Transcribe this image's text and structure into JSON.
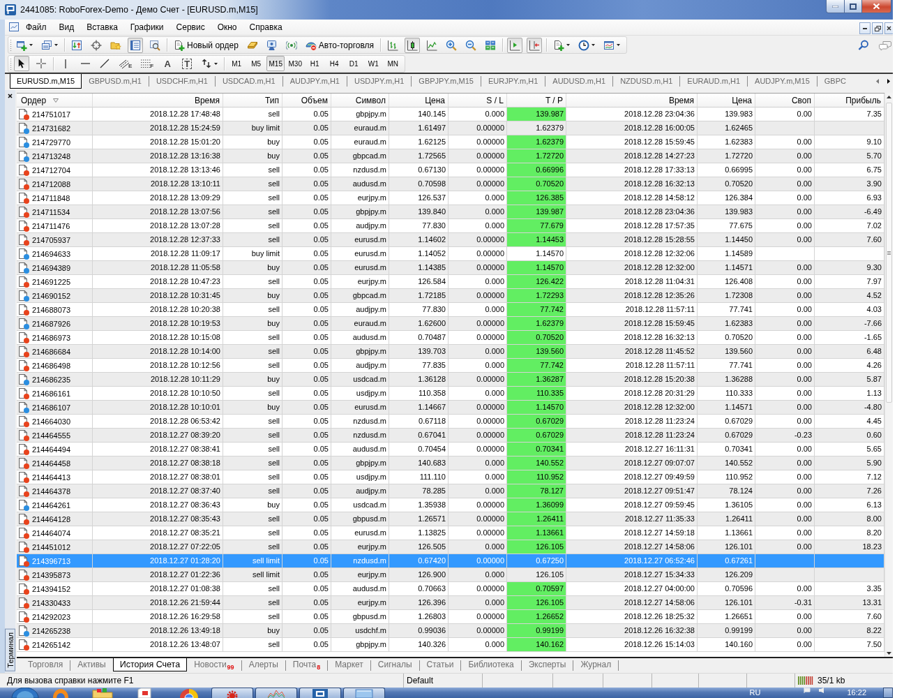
{
  "window": {
    "title": "2441085: RoboForex-Demo - Демо Счет - [EURUSD.m,M15]"
  },
  "menu": [
    "Файл",
    "Вид",
    "Вставка",
    "Графики",
    "Сервис",
    "Окно",
    "Справка"
  ],
  "toolbar_standard": [
    [
      {
        "kind": "newchart",
        "pressed": false
      },
      {
        "kind": "profiles",
        "pressed": false
      }
    ],
    [
      {
        "kind": "marketwatch",
        "pressed": false
      },
      {
        "kind": "datawindow",
        "pressed": false
      },
      {
        "kind": "navigator",
        "pressed": false
      },
      {
        "kind": "terminal",
        "pressed": true
      },
      {
        "kind": "tester",
        "pressed": false
      }
    ],
    [
      {
        "kind": "neworder",
        "label": "Новый ордер",
        "pressed": false
      },
      {
        "kind": "editor",
        "pressed": false
      },
      {
        "kind": "market",
        "pressed": false
      },
      {
        "kind": "signals",
        "pressed": false
      },
      {
        "kind": "autotrading",
        "label": "Авто-торговля",
        "pressed": false
      }
    ],
    [
      {
        "kind": "bars",
        "pressed": false
      },
      {
        "kind": "candles",
        "pressed": true
      },
      {
        "kind": "line",
        "pressed": false
      },
      {
        "kind": "zoomin",
        "pressed": false
      },
      {
        "kind": "zoomout",
        "pressed": false
      },
      {
        "kind": "tile",
        "pressed": false
      }
    ],
    [
      {
        "kind": "autoscroll",
        "pressed": true
      },
      {
        "kind": "shift",
        "pressed": true
      }
    ],
    [
      {
        "kind": "indicators",
        "pressed": false
      },
      {
        "kind": "periods",
        "pressed": false
      },
      {
        "kind": "templates",
        "pressed": false
      }
    ]
  ],
  "toolbar_drawing": [
    [
      {
        "kind": "cursor",
        "pressed": true
      },
      {
        "kind": "crosshair",
        "pressed": false
      }
    ],
    [
      {
        "kind": "vline",
        "pressed": false
      },
      {
        "kind": "hline",
        "pressed": false
      },
      {
        "kind": "trendline",
        "pressed": false
      },
      {
        "kind": "channel",
        "glyph": "E",
        "pressed": false
      },
      {
        "kind": "fibo",
        "glyph": "F",
        "pressed": false
      },
      {
        "kind": "text",
        "glyph": "A",
        "pressed": false
      },
      {
        "kind": "label",
        "glyph": "T",
        "pressed": false
      },
      {
        "kind": "arrows",
        "pressed": false
      }
    ]
  ],
  "timeframes": [
    {
      "label": "M1",
      "selected": false
    },
    {
      "label": "M5",
      "selected": false
    },
    {
      "label": "M15",
      "selected": true
    },
    {
      "label": "M30",
      "selected": false
    },
    {
      "label": "H1",
      "selected": false
    },
    {
      "label": "H4",
      "selected": false
    },
    {
      "label": "D1",
      "selected": false
    },
    {
      "label": "W1",
      "selected": false
    },
    {
      "label": "MN",
      "selected": false
    }
  ],
  "chart_tabs": [
    {
      "label": "EURUSD.m,M15",
      "selected": true
    },
    {
      "label": "GBPUSD.m,H1",
      "selected": false
    },
    {
      "label": "USDCHF.m,H1",
      "selected": false
    },
    {
      "label": "USDCAD.m,H1",
      "selected": false
    },
    {
      "label": "AUDJPY.m,H1",
      "selected": false
    },
    {
      "label": "USDJPY.m,H1",
      "selected": false
    },
    {
      "label": "GBPJPY.m,M15",
      "selected": false
    },
    {
      "label": "EURJPY.m,H1",
      "selected": false
    },
    {
      "label": "AUDUSD.m,H1",
      "selected": false
    },
    {
      "label": "NZDUSD.m,H1",
      "selected": false
    },
    {
      "label": "EURAUD.m,H1",
      "selected": false
    },
    {
      "label": "AUDJPY.m,M15",
      "selected": false
    },
    {
      "label": "GBPC",
      "selected": false
    }
  ],
  "terminal": {
    "title": "Терминал",
    "columns": [
      {
        "label": "Ордер",
        "sorted": true
      },
      {
        "label": "Время",
        "sorted": false
      },
      {
        "label": "Тип",
        "sorted": false
      },
      {
        "label": "Объем",
        "sorted": false
      },
      {
        "label": "Символ",
        "sorted": false
      },
      {
        "label": "Цена",
        "sorted": false
      },
      {
        "label": "S / L",
        "sorted": false
      },
      {
        "label": "T / P",
        "sorted": false
      },
      {
        "label": "Время",
        "sorted": false
      },
      {
        "label": "Цена",
        "sorted": false
      },
      {
        "label": "Своп",
        "sorted": false
      },
      {
        "label": "Прибыль",
        "sorted": false
      }
    ],
    "rows": [
      {
        "order": "214751017",
        "color": "#e8431d",
        "time": "2018.12.28 17:48:48",
        "type": "sell",
        "volume": "0.05",
        "symbol": "gbpjpy.m",
        "price": "140.145",
        "sl": "0.000",
        "tp": "139.987",
        "tp_hit": true,
        "close_time": "2018.12.28 23:04:36",
        "close_price": "139.983",
        "swap": "0.00",
        "profit": "7.35",
        "selected": false
      },
      {
        "order": "214731682",
        "color": "#2b8ee0",
        "time": "2018.12.28 15:24:59",
        "type": "buy limit",
        "volume": "0.05",
        "symbol": "euraud.m",
        "price": "1.61497",
        "sl": "0.00000",
        "tp": "1.62379",
        "tp_hit": false,
        "close_time": "2018.12.28 16:00:05",
        "close_price": "1.62465",
        "selected": false
      },
      {
        "order": "214729770",
        "color": "#2b8ee0",
        "time": "2018.12.28 15:01:20",
        "type": "buy",
        "volume": "0.05",
        "symbol": "euraud.m",
        "price": "1.62125",
        "sl": "0.00000",
        "tp": "1.62379",
        "tp_hit": true,
        "close_time": "2018.12.28 15:59:45",
        "close_price": "1.62383",
        "swap": "0.00",
        "profit": "9.10",
        "selected": false
      },
      {
        "order": "214713248",
        "color": "#2b8ee0",
        "time": "2018.12.28 13:16:38",
        "type": "buy",
        "volume": "0.05",
        "symbol": "gbpcad.m",
        "price": "1.72565",
        "sl": "0.00000",
        "tp": "1.72720",
        "tp_hit": true,
        "close_time": "2018.12.28 14:27:23",
        "close_price": "1.72720",
        "swap": "0.00",
        "profit": "5.70",
        "selected": false
      },
      {
        "order": "214712704",
        "color": "#e8431d",
        "time": "2018.12.28 13:13:46",
        "type": "sell",
        "volume": "0.05",
        "symbol": "nzdusd.m",
        "price": "0.67130",
        "sl": "0.00000",
        "tp": "0.66996",
        "tp_hit": true,
        "close_time": "2018.12.28 17:33:13",
        "close_price": "0.66995",
        "swap": "0.00",
        "profit": "6.75",
        "selected": false
      },
      {
        "order": "214712088",
        "color": "#e8431d",
        "time": "2018.12.28 13:10:11",
        "type": "sell",
        "volume": "0.05",
        "symbol": "audusd.m",
        "price": "0.70598",
        "sl": "0.00000",
        "tp": "0.70520",
        "tp_hit": true,
        "close_time": "2018.12.28 16:32:13",
        "close_price": "0.70520",
        "swap": "0.00",
        "profit": "3.90",
        "selected": false
      },
      {
        "order": "214711848",
        "color": "#e8431d",
        "time": "2018.12.28 13:09:29",
        "type": "sell",
        "volume": "0.05",
        "symbol": "eurjpy.m",
        "price": "126.537",
        "sl": "0.000",
        "tp": "126.385",
        "tp_hit": true,
        "close_time": "2018.12.28 14:58:12",
        "close_price": "126.384",
        "swap": "0.00",
        "profit": "6.93",
        "selected": false
      },
      {
        "order": "214711534",
        "color": "#e8431d",
        "time": "2018.12.28 13:07:56",
        "type": "sell",
        "volume": "0.05",
        "symbol": "gbpjpy.m",
        "price": "139.840",
        "sl": "0.000",
        "tp": "139.987",
        "tp_hit": true,
        "close_time": "2018.12.28 23:04:36",
        "close_price": "139.983",
        "swap": "0.00",
        "profit": "-6.49",
        "selected": false
      },
      {
        "order": "214711476",
        "color": "#e8431d",
        "time": "2018.12.28 13:07:28",
        "type": "sell",
        "volume": "0.05",
        "symbol": "audjpy.m",
        "price": "77.830",
        "sl": "0.000",
        "tp": "77.679",
        "tp_hit": true,
        "close_time": "2018.12.28 17:57:35",
        "close_price": "77.675",
        "swap": "0.00",
        "profit": "7.02",
        "selected": false
      },
      {
        "order": "214705937",
        "color": "#e8431d",
        "time": "2018.12.28 12:37:33",
        "type": "sell",
        "volume": "0.05",
        "symbol": "eurusd.m",
        "price": "1.14602",
        "sl": "0.00000",
        "tp": "1.14453",
        "tp_hit": true,
        "close_time": "2018.12.28 15:28:55",
        "close_price": "1.14450",
        "swap": "0.00",
        "profit": "7.60",
        "selected": false
      },
      {
        "order": "214694633",
        "color": "#2b8ee0",
        "time": "2018.12.28 11:09:17",
        "type": "buy limit",
        "volume": "0.05",
        "symbol": "eurusd.m",
        "price": "1.14052",
        "sl": "0.00000",
        "tp": "1.14570",
        "tp_hit": false,
        "close_time": "2018.12.28 12:32:06",
        "close_price": "1.14589",
        "selected": false
      },
      {
        "order": "214694389",
        "color": "#2b8ee0",
        "time": "2018.12.28 11:05:58",
        "type": "buy",
        "volume": "0.05",
        "symbol": "eurusd.m",
        "price": "1.14385",
        "sl": "0.00000",
        "tp": "1.14570",
        "tp_hit": true,
        "close_time": "2018.12.28 12:32:00",
        "close_price": "1.14571",
        "swap": "0.00",
        "profit": "9.30",
        "selected": false
      },
      {
        "order": "214691225",
        "color": "#e8431d",
        "time": "2018.12.28 10:47:23",
        "type": "sell",
        "volume": "0.05",
        "symbol": "eurjpy.m",
        "price": "126.584",
        "sl": "0.000",
        "tp": "126.422",
        "tp_hit": true,
        "close_time": "2018.12.28 11:04:31",
        "close_price": "126.408",
        "swap": "0.00",
        "profit": "7.97",
        "selected": false
      },
      {
        "order": "214690152",
        "color": "#2b8ee0",
        "time": "2018.12.28 10:31:45",
        "type": "buy",
        "volume": "0.05",
        "symbol": "gbpcad.m",
        "price": "1.72185",
        "sl": "0.00000",
        "tp": "1.72293",
        "tp_hit": true,
        "close_time": "2018.12.28 12:35:26",
        "close_price": "1.72308",
        "swap": "0.00",
        "profit": "4.52",
        "selected": false
      },
      {
        "order": "214688073",
        "color": "#e8431d",
        "time": "2018.12.28 10:20:38",
        "type": "sell",
        "volume": "0.05",
        "symbol": "audjpy.m",
        "price": "77.830",
        "sl": "0.000",
        "tp": "77.742",
        "tp_hit": true,
        "close_time": "2018.12.28 11:57:11",
        "close_price": "77.741",
        "swap": "0.00",
        "profit": "4.03",
        "selected": false
      },
      {
        "order": "214687926",
        "color": "#2b8ee0",
        "time": "2018.12.28 10:19:53",
        "type": "buy",
        "volume": "0.05",
        "symbol": "euraud.m",
        "price": "1.62600",
        "sl": "0.00000",
        "tp": "1.62379",
        "tp_hit": true,
        "close_time": "2018.12.28 15:59:45",
        "close_price": "1.62383",
        "swap": "0.00",
        "profit": "-7.66",
        "selected": false
      },
      {
        "order": "214686973",
        "color": "#e8431d",
        "time": "2018.12.28 10:15:08",
        "type": "sell",
        "volume": "0.05",
        "symbol": "audusd.m",
        "price": "0.70487",
        "sl": "0.00000",
        "tp": "0.70520",
        "tp_hit": true,
        "close_time": "2018.12.28 16:32:13",
        "close_price": "0.70520",
        "swap": "0.00",
        "profit": "-1.65",
        "selected": false
      },
      {
        "order": "214686684",
        "color": "#e8431d",
        "time": "2018.12.28 10:14:00",
        "type": "sell",
        "volume": "0.05",
        "symbol": "gbpjpy.m",
        "price": "139.703",
        "sl": "0.000",
        "tp": "139.560",
        "tp_hit": true,
        "close_time": "2018.12.28 11:45:52",
        "close_price": "139.560",
        "swap": "0.00",
        "profit": "6.48",
        "selected": false
      },
      {
        "order": "214686498",
        "color": "#e8431d",
        "time": "2018.12.28 10:12:56",
        "type": "sell",
        "volume": "0.05",
        "symbol": "audjpy.m",
        "price": "77.835",
        "sl": "0.000",
        "tp": "77.742",
        "tp_hit": true,
        "close_time": "2018.12.28 11:57:11",
        "close_price": "77.741",
        "swap": "0.00",
        "profit": "4.26",
        "selected": false
      },
      {
        "order": "214686235",
        "color": "#2b8ee0",
        "time": "2018.12.28 10:11:29",
        "type": "buy",
        "volume": "0.05",
        "symbol": "usdcad.m",
        "price": "1.36128",
        "sl": "0.00000",
        "tp": "1.36287",
        "tp_hit": true,
        "close_time": "2018.12.28 15:20:38",
        "close_price": "1.36288",
        "swap": "0.00",
        "profit": "5.87",
        "selected": false
      },
      {
        "order": "214686161",
        "color": "#e8431d",
        "time": "2018.12.28 10:10:50",
        "type": "sell",
        "volume": "0.05",
        "symbol": "usdjpy.m",
        "price": "110.358",
        "sl": "0.000",
        "tp": "110.335",
        "tp_hit": true,
        "close_time": "2018.12.28 20:31:29",
        "close_price": "110.333",
        "swap": "0.00",
        "profit": "1.13",
        "selected": false
      },
      {
        "order": "214686107",
        "color": "#2b8ee0",
        "time": "2018.12.28 10:10:01",
        "type": "buy",
        "volume": "0.05",
        "symbol": "eurusd.m",
        "price": "1.14667",
        "sl": "0.00000",
        "tp": "1.14570",
        "tp_hit": true,
        "close_time": "2018.12.28 12:32:00",
        "close_price": "1.14571",
        "swap": "0.00",
        "profit": "-4.80",
        "selected": false
      },
      {
        "order": "214664030",
        "color": "#e8431d",
        "time": "2018.12.28 06:53:42",
        "type": "sell",
        "volume": "0.05",
        "symbol": "nzdusd.m",
        "price": "0.67118",
        "sl": "0.00000",
        "tp": "0.67029",
        "tp_hit": true,
        "close_time": "2018.12.28 11:23:24",
        "close_price": "0.67029",
        "swap": "0.00",
        "profit": "4.45",
        "selected": false
      },
      {
        "order": "214464555",
        "color": "#e8431d",
        "time": "2018.12.27 08:39:20",
        "type": "sell",
        "volume": "0.05",
        "symbol": "nzdusd.m",
        "price": "0.67041",
        "sl": "0.00000",
        "tp": "0.67029",
        "tp_hit": true,
        "close_time": "2018.12.28 11:23:24",
        "close_price": "0.67029",
        "swap": "-0.23",
        "profit": "0.60",
        "selected": false
      },
      {
        "order": "214464494",
        "color": "#e8431d",
        "time": "2018.12.27 08:38:41",
        "type": "sell",
        "volume": "0.05",
        "symbol": "audusd.m",
        "price": "0.70454",
        "sl": "0.00000",
        "tp": "0.70341",
        "tp_hit": true,
        "close_time": "2018.12.27 16:11:31",
        "close_price": "0.70341",
        "swap": "0.00",
        "profit": "5.65",
        "selected": false
      },
      {
        "order": "214464458",
        "color": "#e8431d",
        "time": "2018.12.27 08:38:18",
        "type": "sell",
        "volume": "0.05",
        "symbol": "gbpjpy.m",
        "price": "140.683",
        "sl": "0.000",
        "tp": "140.552",
        "tp_hit": true,
        "close_time": "2018.12.27 09:07:07",
        "close_price": "140.552",
        "swap": "0.00",
        "profit": "5.90",
        "selected": false
      },
      {
        "order": "214464413",
        "color": "#e8431d",
        "time": "2018.12.27 08:38:01",
        "type": "sell",
        "volume": "0.05",
        "symbol": "usdjpy.m",
        "price": "111.110",
        "sl": "0.000",
        "tp": "110.952",
        "tp_hit": true,
        "close_time": "2018.12.27 09:49:59",
        "close_price": "110.952",
        "swap": "0.00",
        "profit": "7.12",
        "selected": false
      },
      {
        "order": "214464378",
        "color": "#e8431d",
        "time": "2018.12.27 08:37:40",
        "type": "sell",
        "volume": "0.05",
        "symbol": "audjpy.m",
        "price": "78.285",
        "sl": "0.000",
        "tp": "78.127",
        "tp_hit": true,
        "close_time": "2018.12.27 09:51:47",
        "close_price": "78.124",
        "swap": "0.00",
        "profit": "7.26",
        "selected": false
      },
      {
        "order": "214464261",
        "color": "#2b8ee0",
        "time": "2018.12.27 08:36:43",
        "type": "buy",
        "volume": "0.05",
        "symbol": "usdcad.m",
        "price": "1.35938",
        "sl": "0.00000",
        "tp": "1.36099",
        "tp_hit": true,
        "close_time": "2018.12.27 09:59:45",
        "close_price": "1.36105",
        "swap": "0.00",
        "profit": "6.13",
        "selected": false
      },
      {
        "order": "214464128",
        "color": "#e8431d",
        "time": "2018.12.27 08:35:43",
        "type": "sell",
        "volume": "0.05",
        "symbol": "gbpusd.m",
        "price": "1.26571",
        "sl": "0.00000",
        "tp": "1.26411",
        "tp_hit": true,
        "close_time": "2018.12.27 11:35:33",
        "close_price": "1.26411",
        "swap": "0.00",
        "profit": "8.00",
        "selected": false
      },
      {
        "order": "214464074",
        "color": "#e8431d",
        "time": "2018.12.27 08:35:21",
        "type": "sell",
        "volume": "0.05",
        "symbol": "eurusd.m",
        "price": "1.13825",
        "sl": "0.00000",
        "tp": "1.13661",
        "tp_hit": true,
        "close_time": "2018.12.27 14:59:18",
        "close_price": "1.13661",
        "swap": "0.00",
        "profit": "8.20",
        "selected": false
      },
      {
        "order": "214451012",
        "color": "#e8431d",
        "time": "2018.12.27 07:22:05",
        "type": "sell",
        "volume": "0.05",
        "symbol": "eurjpy.m",
        "price": "126.505",
        "sl": "0.000",
        "tp": "126.105",
        "tp_hit": true,
        "close_time": "2018.12.27 14:58:06",
        "close_price": "126.101",
        "swap": "0.00",
        "profit": "18.23",
        "selected": false
      },
      {
        "order": "214396713",
        "color": "#e8431d",
        "time": "2018.12.27 01:28:20",
        "type": "sell limit",
        "volume": "0.05",
        "symbol": "nzdusd.m",
        "price": "0.67420",
        "sl": "0.00000",
        "tp": "0.67250",
        "tp_hit": false,
        "close_time": "2018.12.27 06:52:46",
        "close_price": "0.67261",
        "selected": true
      },
      {
        "order": "214395873",
        "color": "#e8431d",
        "time": "2018.12.27 01:22:36",
        "type": "sell limit",
        "volume": "0.05",
        "symbol": "eurjpy.m",
        "price": "126.900",
        "sl": "0.000",
        "tp": "126.105",
        "tp_hit": false,
        "close_time": "2018.12.27 15:34:33",
        "close_price": "126.209",
        "selected": false
      },
      {
        "order": "214394152",
        "color": "#e8431d",
        "time": "2018.12.27 01:08:38",
        "type": "sell",
        "volume": "0.05",
        "symbol": "audusd.m",
        "price": "0.70663",
        "sl": "0.00000",
        "tp": "0.70597",
        "tp_hit": true,
        "close_time": "2018.12.27 04:00:00",
        "close_price": "0.70596",
        "swap": "0.00",
        "profit": "3.35",
        "selected": false
      },
      {
        "order": "214330433",
        "color": "#e8431d",
        "time": "2018.12.26 21:59:44",
        "type": "sell",
        "volume": "0.05",
        "symbol": "eurjpy.m",
        "price": "126.396",
        "sl": "0.000",
        "tp": "126.105",
        "tp_hit": true,
        "close_time": "2018.12.27 14:58:06",
        "close_price": "126.101",
        "swap": "-0.31",
        "profit": "13.31",
        "selected": false
      },
      {
        "order": "214292023",
        "color": "#e8431d",
        "time": "2018.12.26 16:29:58",
        "type": "sell",
        "volume": "0.05",
        "symbol": "gbpusd.m",
        "price": "1.26803",
        "sl": "0.00000",
        "tp": "1.26652",
        "tp_hit": true,
        "close_time": "2018.12.26 18:25:32",
        "close_price": "1.26651",
        "swap": "0.00",
        "profit": "7.60",
        "selected": false
      },
      {
        "order": "214265238",
        "color": "#2b8ee0",
        "time": "2018.12.26 13:49:18",
        "type": "buy",
        "volume": "0.05",
        "symbol": "usdchf.m",
        "price": "0.99036",
        "sl": "0.00000",
        "tp": "0.99199",
        "tp_hit": true,
        "close_time": "2018.12.26 16:32:38",
        "close_price": "0.99199",
        "swap": "0.00",
        "profit": "8.22",
        "selected": false
      },
      {
        "order": "214265142",
        "color": "#e8431d",
        "time": "2018.12.26 13:48:07",
        "type": "sell",
        "volume": "0.05",
        "symbol": "gbpjpy.m",
        "price": "140.326",
        "sl": "0.000",
        "tp": "140.162",
        "tp_hit": true,
        "close_time": "2018.12.26 15:14:03",
        "close_price": "140.160",
        "swap": "0.00",
        "profit": "7.50",
        "selected": false
      }
    ]
  },
  "terminal_tabs": [
    {
      "label": "Торговля",
      "selected": false
    },
    {
      "label": "Активы",
      "selected": false
    },
    {
      "label": "История Счета",
      "selected": true
    },
    {
      "label": "Новости",
      "badge": "99",
      "selected": false
    },
    {
      "label": "Алерты",
      "selected": false
    },
    {
      "label": "Почта",
      "badge": "8",
      "selected": false
    },
    {
      "label": "Маркет",
      "selected": false
    },
    {
      "label": "Сигналы",
      "selected": false
    },
    {
      "label": "Статьи",
      "selected": false
    },
    {
      "label": "Библиотека",
      "selected": false
    },
    {
      "label": "Эксперты",
      "selected": false
    },
    {
      "label": "Журнал",
      "selected": false
    }
  ],
  "status_bar": {
    "hint": "Для вызова справки нажмите F1",
    "profile": "Default",
    "traffic": "35/1 kb"
  },
  "taskbar": {
    "language": "RU",
    "clock": "16:22"
  }
}
